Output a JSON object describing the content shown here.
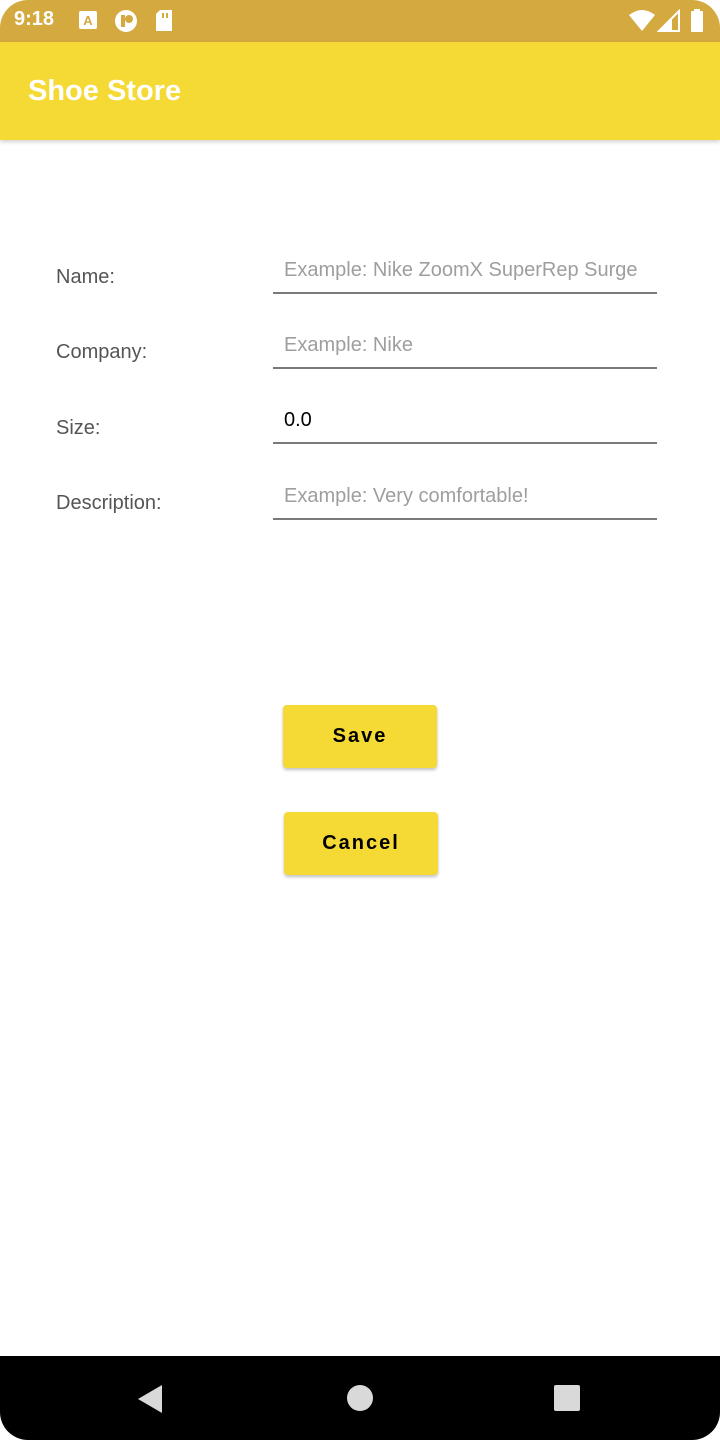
{
  "status_bar": {
    "time": "9:18",
    "icons": [
      "a-keyboard-icon",
      "vpn-icon",
      "sd-card-icon",
      "wifi-icon",
      "signal-icon",
      "battery-icon"
    ],
    "color": "#d4aa40"
  },
  "app_bar": {
    "title": "Shoe Store",
    "color": "#f5d935"
  },
  "form": {
    "name": {
      "label": "Name:",
      "value": "",
      "placeholder": "Example: Nike ZoomX SuperRep Surge"
    },
    "company": {
      "label": "Company:",
      "value": "",
      "placeholder": "Example: Nike"
    },
    "size": {
      "label": "Size:",
      "value": "0.0",
      "placeholder": ""
    },
    "description": {
      "label": "Description:",
      "value": "",
      "placeholder": "Example: Very comfortable!"
    }
  },
  "buttons": {
    "save_label": "Save",
    "cancel_label": "Cancel",
    "color": "#f5d935"
  },
  "nav_bar": {
    "items": [
      "back-icon",
      "home-icon",
      "recents-icon"
    ]
  }
}
